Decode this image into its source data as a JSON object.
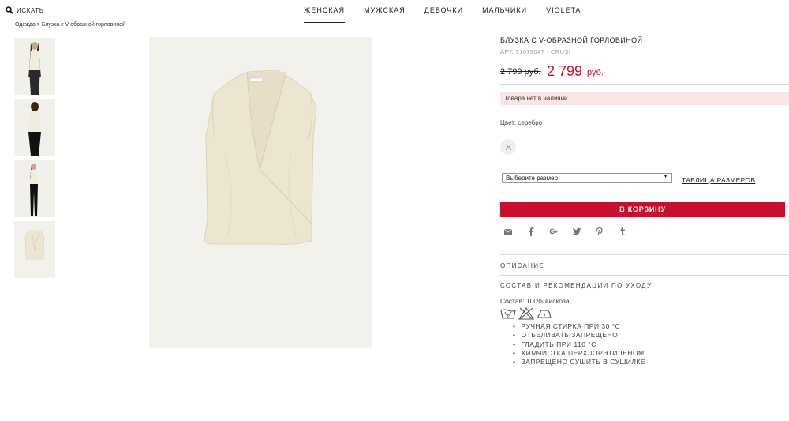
{
  "header": {
    "search_label": "ИСКАТЬ",
    "nav": [
      {
        "label": "ЖЕНСКАЯ",
        "active": true
      },
      {
        "label": "МУЖСКАЯ",
        "active": false
      },
      {
        "label": "ДЕВОЧКИ",
        "active": false
      },
      {
        "label": "МАЛЬЧИКИ",
        "active": false
      },
      {
        "label": "VIOLETA",
        "active": false
      }
    ]
  },
  "breadcrumb": "Одежда > Блузка с V-образной горловиной",
  "product": {
    "title": "БЛУЗКА С V-ОБРАЗНОЙ ГОРЛОВИНОЙ",
    "sku": "АРТ. 51079047 - CRUSI",
    "old_price": "2 799 руб.",
    "new_price": "2 799",
    "currency": "руб.",
    "stock_alert": "Товара нет в наличии.",
    "color_label": "Цвет: серебро",
    "size_placeholder": "Выберите размер",
    "size_table_link": "ТАБЛИЦА РАЗМЕРОВ",
    "add_to_cart": "В КОРЗИНУ",
    "description_title": "ОПИСАНИЕ",
    "care_title": "СОСТАВ И РЕКОМЕНДАЦИИ ПО УХОДУ",
    "composition": "Состав: 100% вискоза,",
    "care_items": [
      "РУЧНАЯ СТИРКА ПРИ 30 °C",
      "ОТБЕЛИВАТЬ ЗАПРЕЩЕНО",
      "ГЛАДИТЬ ПРИ 110 °C",
      "ХИМЧИСТКА ПЕРХЛОРЭТИЛЕНОМ",
      "ЗАПРЕЩЕНО СУШИТЬ В СУШИЛКЕ"
    ]
  },
  "social_icons": [
    "mail-icon",
    "facebook-icon",
    "google-plus-icon",
    "twitter-icon",
    "pinterest-icon",
    "tumblr-icon"
  ],
  "colors": {
    "accent": "#c8102e",
    "alert_bg": "#fbe5e5",
    "product_bg": "#f3f1ec"
  }
}
